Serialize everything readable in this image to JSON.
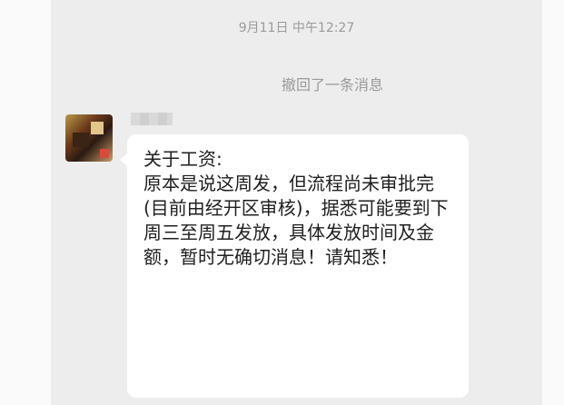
{
  "chat": {
    "timestamp": "9月11日 中午12:27",
    "system_notice": "撤回了一条消息",
    "message": {
      "sender_name": "",
      "text": "关于工资:\n原本是说这周发，但流程尚未审批完(目前由经开区审核)，据悉可能要到下周三至周五发放，具体发放时间及金额，暂时无确切消息！请知悉！"
    }
  }
}
